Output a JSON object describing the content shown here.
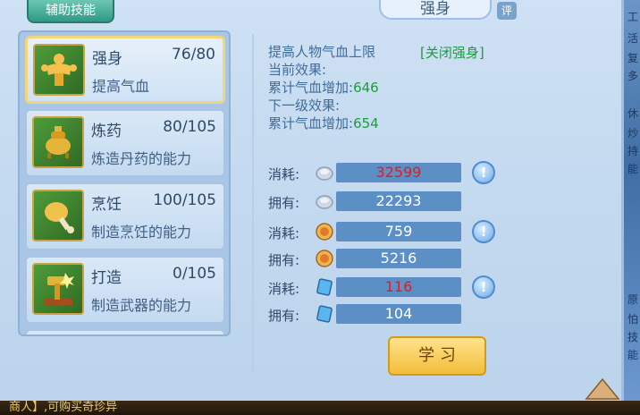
{
  "tab": {
    "label": "辅助技能"
  },
  "header": {
    "title": "强身",
    "rate_label": "评"
  },
  "skills": [
    {
      "name": "强身",
      "level": "76/80",
      "desc": "提高气血",
      "icon": "muscle-man-icon"
    },
    {
      "name": "炼药",
      "level": "80/105",
      "desc": "炼造丹药的能力",
      "icon": "cauldron-icon"
    },
    {
      "name": "烹饪",
      "level": "100/105",
      "desc": "制造烹饪的能力",
      "icon": "drumstick-icon"
    },
    {
      "name": "打造",
      "level": "0/105",
      "desc": "制造武器的能力",
      "icon": "hammer-icon"
    }
  ],
  "info": {
    "line1": "提高人物气血上限",
    "toggle": "[关闭强身]",
    "current_label": "当前效果:",
    "current_value_label": "累计气血增加:",
    "current_value": "646",
    "next_label": "下一级效果:",
    "next_value_label": "累计气血增加:",
    "next_value": "654"
  },
  "resources": [
    {
      "label": "消耗:",
      "icon": "silver-coin-icon",
      "value": "32599",
      "value_color": "red",
      "has_info": true
    },
    {
      "label": "拥有:",
      "icon": "silver-coin-icon",
      "value": "22293",
      "value_color": "white",
      "has_info": false
    },
    {
      "label": "消耗:",
      "icon": "contribution-medal-icon",
      "value": "759",
      "value_color": "white",
      "has_info": true
    },
    {
      "label": "拥有:",
      "icon": "contribution-medal-icon",
      "value": "5216",
      "value_color": "white",
      "has_info": false
    },
    {
      "label": "消耗:",
      "icon": "scroll-card-icon",
      "value": "116",
      "value_color": "red",
      "has_info": true
    },
    {
      "label": "拥有:",
      "icon": "scroll-card-icon",
      "value": "104",
      "value_color": "white",
      "has_info": false
    }
  ],
  "learn_button": {
    "label": "学 习"
  },
  "bottom": {
    "ticker": "商人】,可购买奇珍异"
  },
  "right_strip": [
    "工",
    "活",
    "复",
    "多",
    "休",
    "炒",
    "持",
    "能",
    "原",
    "怕",
    "技",
    "能"
  ],
  "colors": {
    "accent_green": "#1e9b3f",
    "cost_red": "#e31b1b",
    "panel_blue": "#c3d9ef"
  }
}
